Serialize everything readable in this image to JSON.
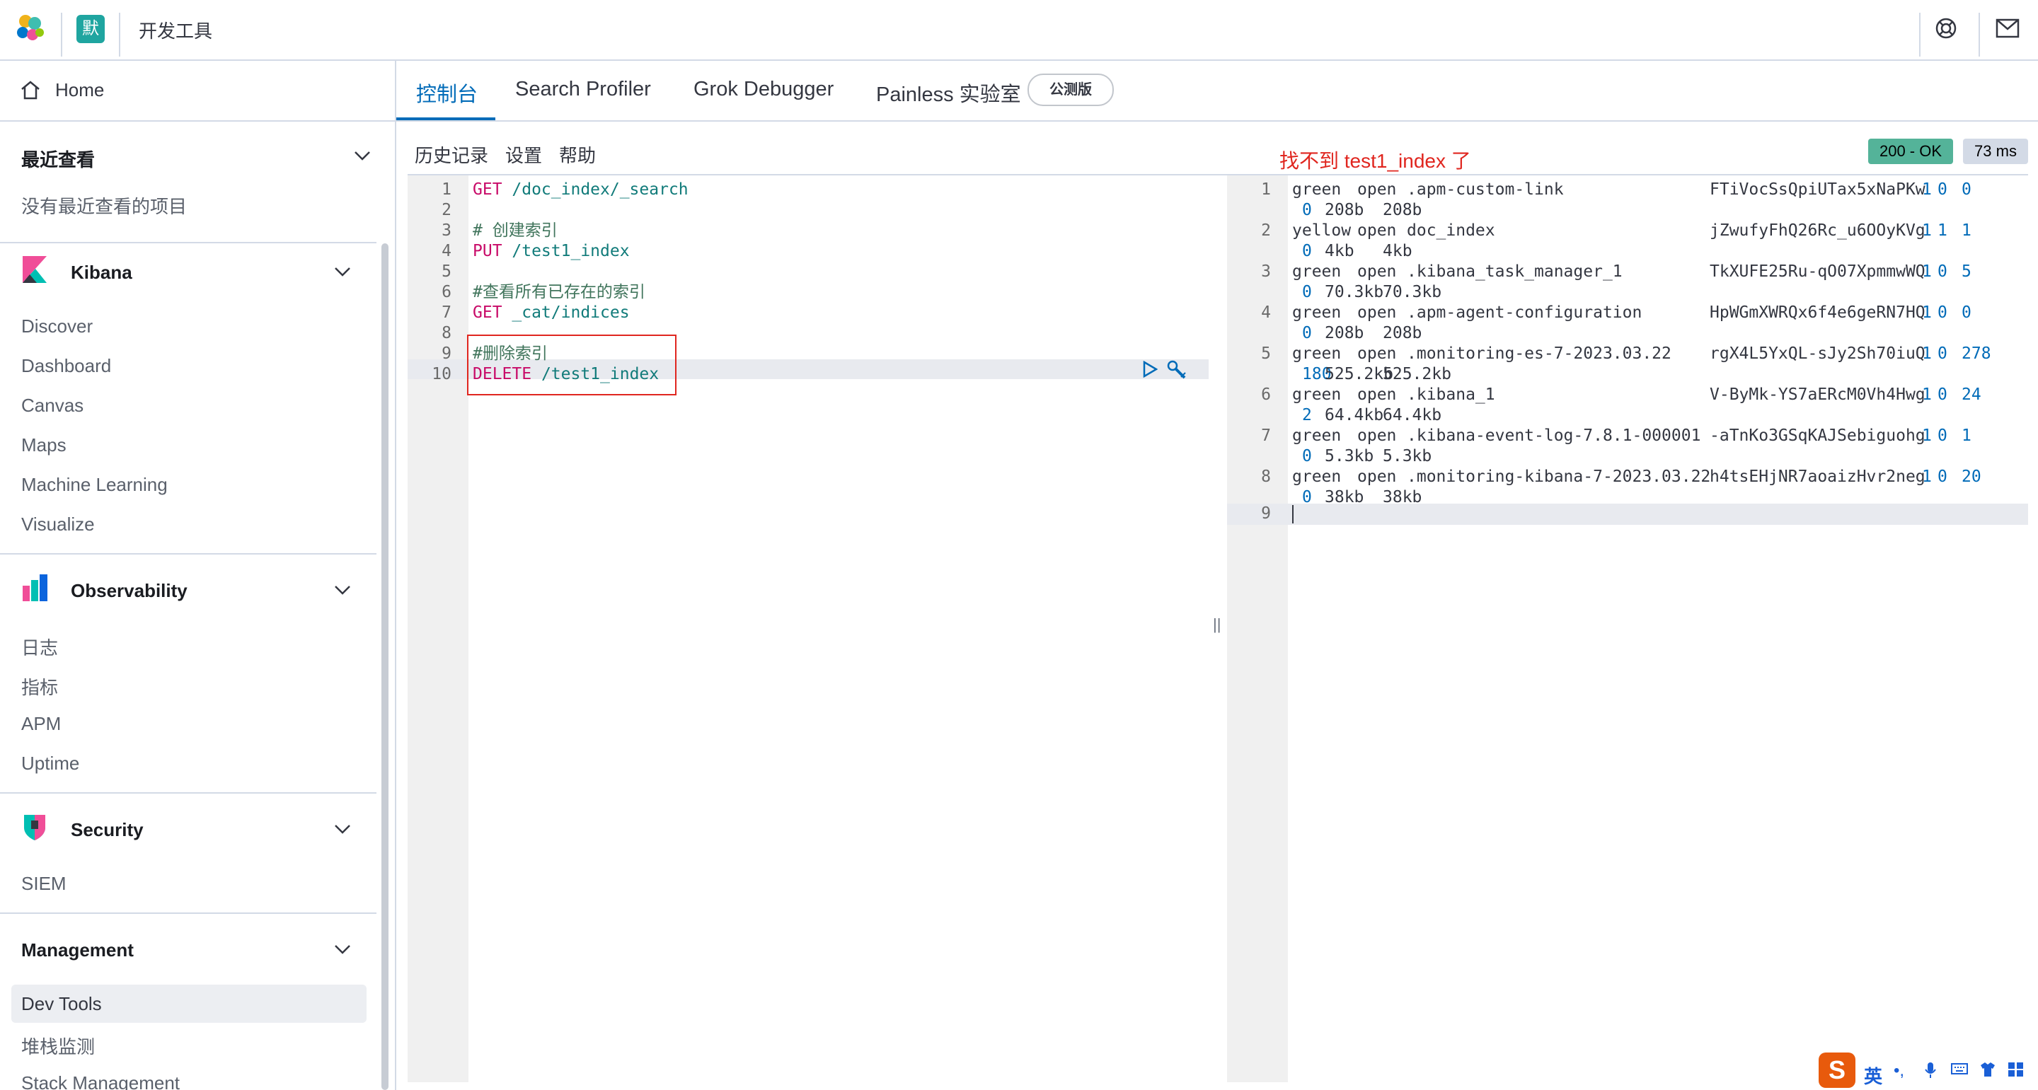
{
  "header": {
    "space_avatar": "默",
    "app_title": "开发工具"
  },
  "sidebar": {
    "home": "Home",
    "recent": {
      "title": "最近查看",
      "empty": "没有最近查看的项目"
    },
    "kibana": {
      "title": "Kibana",
      "items": [
        "Discover",
        "Dashboard",
        "Canvas",
        "Maps",
        "Machine Learning",
        "Visualize"
      ]
    },
    "observability": {
      "title": "Observability",
      "items": [
        "日志",
        "指标",
        "APM",
        "Uptime"
      ]
    },
    "security": {
      "title": "Security",
      "items": [
        "SIEM"
      ]
    },
    "management": {
      "title": "Management",
      "items": [
        "Dev Tools",
        "堆栈监测",
        "Stack Management"
      ],
      "active": "Dev Tools"
    }
  },
  "tabs": {
    "console": "控制台",
    "search_profiler": "Search Profiler",
    "grok": "Grok Debugger",
    "painless": "Painless 实验室",
    "beta": "公测版"
  },
  "toolbar": {
    "history": "历史记录",
    "settings": "设置",
    "help": "帮助"
  },
  "annotation": "找不到 test1_index 了",
  "status": {
    "code": "200 - OK",
    "time": "73 ms"
  },
  "editor": {
    "active_line": 10,
    "lines": [
      "GET /doc_index/_search",
      "",
      "# 创建索引",
      "PUT /test1_index",
      "",
      "#查看所有已存在的索引",
      "GET _cat/indices",
      "",
      "#删除索引",
      "DELETE /test1_index"
    ]
  },
  "output": {
    "rows": [
      {
        "health": "green",
        "status": "open",
        "index": ".apm-custom-link",
        "uuid": "FTiVocSsQpiUTax5xNaPKw",
        "pri": "1",
        "rep": "0",
        "docs_count": "0",
        "docs_deleted": "0",
        "store_size": "208b",
        "pri_store_size": "208b"
      },
      {
        "health": "yellow",
        "status": "open",
        "index": "doc_index",
        "uuid": "jZwufyFhQ26Rc_u6OOyKVg",
        "pri": "1",
        "rep": "1",
        "docs_count": "1",
        "docs_deleted": "0",
        "store_size": "4kb",
        "pri_store_size": "4kb"
      },
      {
        "health": "green",
        "status": "open",
        "index": ".kibana_task_manager_1",
        "uuid": "TkXUFE25Ru-qO07XpmmwWQ",
        "pri": "1",
        "rep": "0",
        "docs_count": "5",
        "docs_deleted": "0",
        "store_size": "70.3kb",
        "pri_store_size": "70.3kb"
      },
      {
        "health": "green",
        "status": "open",
        "index": ".apm-agent-configuration",
        "uuid": "HpWGmXWRQx6f4e6geRN7HQ",
        "pri": "1",
        "rep": "0",
        "docs_count": "0",
        "docs_deleted": "0",
        "store_size": "208b",
        "pri_store_size": "208b"
      },
      {
        "health": "green",
        "status": "open",
        "index": ".monitoring-es-7-2023.03.22",
        "uuid": "rgX4L5YxQL-sJy2Sh70iuQ",
        "pri": "1",
        "rep": "0",
        "docs_count": "278",
        "docs_deleted": "180",
        "store_size": "525.2kb",
        "pri_store_size": "525.2kb"
      },
      {
        "health": "green",
        "status": "open",
        "index": ".kibana_1",
        "uuid": "V-ByMk-YS7aERcM0Vh4Hwg",
        "pri": "1",
        "rep": "0",
        "docs_count": "24",
        "docs_deleted": "2",
        "store_size": "64.4kb",
        "pri_store_size": "64.4kb"
      },
      {
        "health": "green",
        "status": "open",
        "index": ".kibana-event-log-7.8.1-000001",
        "uuid": "-aTnKo3GSqKAJSebiguohg",
        "pri": "1",
        "rep": "0",
        "docs_count": "1",
        "docs_deleted": "0",
        "store_size": "5.3kb",
        "pri_store_size": "5.3kb"
      },
      {
        "health": "green",
        "status": "open",
        "index": ".monitoring-kibana-7-2023.03.22",
        "uuid": "h4tsEHjNR7aoaizHvr2neg",
        "pri": "1",
        "rep": "0",
        "docs_count": "20",
        "docs_deleted": "0",
        "store_size": "38kb",
        "pri_store_size": "38kb"
      }
    ],
    "last_line": "9"
  },
  "ime": {
    "lang": "英"
  },
  "colors": {
    "accent": "#006bb8",
    "ok": "#54b399",
    "annotation": "#e0261f"
  }
}
